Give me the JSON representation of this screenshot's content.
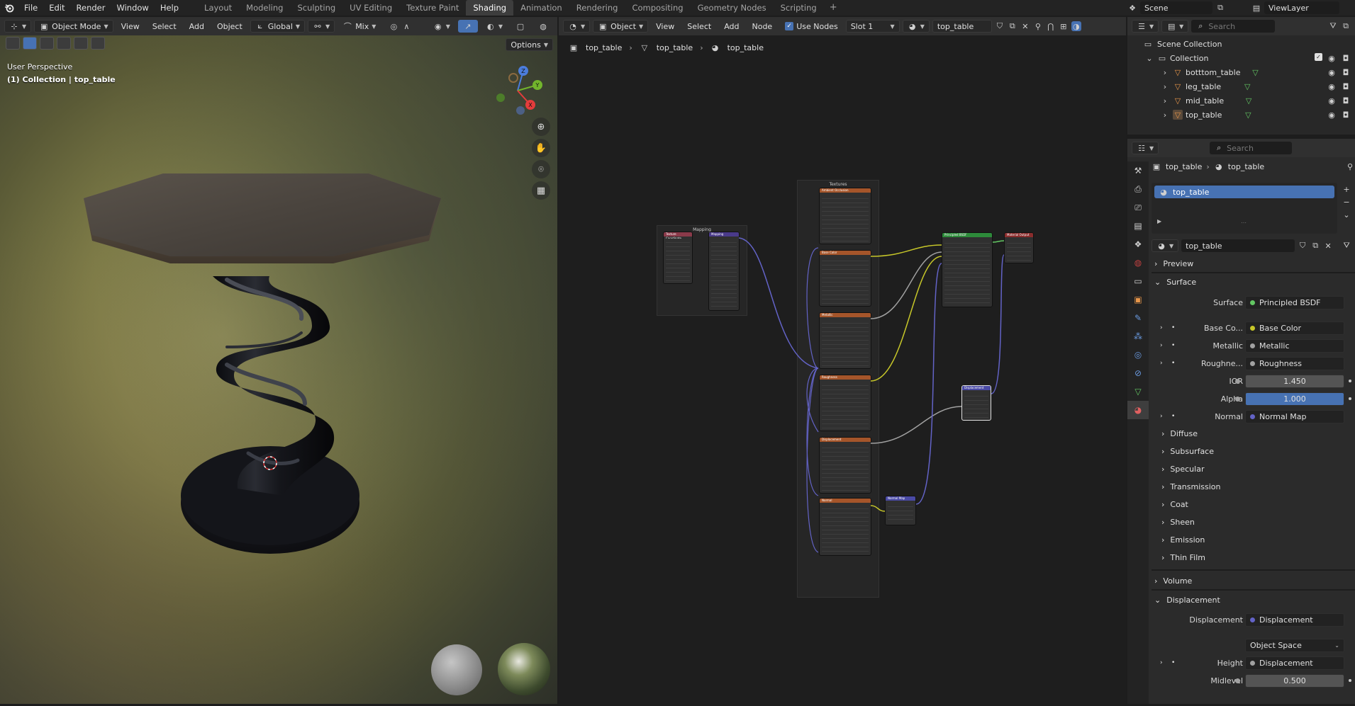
{
  "topbar": {
    "menus": [
      "File",
      "Edit",
      "Render",
      "Window",
      "Help"
    ],
    "workspaces": [
      "Layout",
      "Modeling",
      "Sculpting",
      "UV Editing",
      "Texture Paint",
      "Shading",
      "Animation",
      "Rendering",
      "Compositing",
      "Geometry Nodes",
      "Scripting"
    ],
    "active_workspace": "Shading",
    "add_symbol": "+",
    "scene": "Scene",
    "view_layer": "ViewLayer"
  },
  "viewport": {
    "mode": "Object Mode",
    "menus": [
      "View",
      "Select",
      "Add",
      "Object"
    ],
    "transform_orientation": "Global",
    "shading_mix": "Mix",
    "options": "Options",
    "info_line1": "User Perspective",
    "info_line2": "(1) Collection | top_table",
    "gizmo": {
      "x": "X",
      "y": "Y",
      "z": "Z"
    }
  },
  "node_editor": {
    "object_type": "Object",
    "menus": [
      "View",
      "Select",
      "Add",
      "Node"
    ],
    "use_nodes_label": "Use Nodes",
    "use_nodes": true,
    "slot": "Slot 1",
    "material": "top_table",
    "breadcrumb": [
      "top_table",
      "top_table",
      "top_table"
    ],
    "frames": {
      "mapping": "Mapping",
      "textures": "Textures"
    },
    "nodes": [
      {
        "title": "Texture Coordinate",
        "color": "#8a3a4a"
      },
      {
        "title": "Mapping",
        "color": "#4a3a8a"
      },
      {
        "title": "Ambient Occlusion",
        "color": "#a5552a"
      },
      {
        "title": "Base Color",
        "color": "#a5552a"
      },
      {
        "title": "Metallic",
        "color": "#a5552a"
      },
      {
        "title": "Roughness",
        "color": "#a5552a"
      },
      {
        "title": "Displacement",
        "color": "#a5552a"
      },
      {
        "title": "Normal",
        "color": "#a5552a"
      },
      {
        "title": "Principled BSDF",
        "color": "#2d8a3a"
      },
      {
        "title": "Material Output",
        "color": "#8a2d2d"
      },
      {
        "title": "Displacement",
        "color": "#4a4aa5"
      },
      {
        "title": "Normal Map",
        "color": "#4a4aa5"
      }
    ]
  },
  "outliner": {
    "search_placeholder": "Search",
    "scene_collection": "Scene Collection",
    "collection": "Collection",
    "items": [
      "botttom_table",
      "leg_table",
      "mid_table",
      "top_table"
    ]
  },
  "properties": {
    "search_placeholder": "Search",
    "breadcrumb_object": "top_table",
    "breadcrumb_material": "top_table",
    "slot_name": "top_table",
    "material_name": "top_table",
    "sections": {
      "preview": "Preview",
      "surface": "Surface",
      "volume": "Volume",
      "displacement": "Displacement"
    },
    "surface": {
      "surface_label": "Surface",
      "surface_value": "Principled BSDF",
      "base_color_label": "Base Co...",
      "base_color_value": "Base Color",
      "metallic_label": "Metallic",
      "metallic_value": "Metallic",
      "roughness_label": "Roughne...",
      "roughness_value": "Roughness",
      "ior_label": "IOR",
      "ior_value": "1.450",
      "alpha_label": "Alpha",
      "alpha_value": "1.000",
      "normal_label": "Normal",
      "normal_value": "Normal Map"
    },
    "subpanels": [
      "Diffuse",
      "Subsurface",
      "Specular",
      "Transmission",
      "Coat",
      "Sheen",
      "Emission",
      "Thin Film"
    ],
    "displacement": {
      "displacement_label": "Displacement",
      "displacement_value": "Displacement",
      "space": "Object Space",
      "height_label": "Height",
      "height_value": "Displacement",
      "midlevel_label": "Midlevel",
      "midlevel_value": "0.500"
    },
    "socket_colors": {
      "shader": "#63c763",
      "color": "#c7c729",
      "float": "#a1a1a1",
      "vector": "#6363c7"
    }
  }
}
